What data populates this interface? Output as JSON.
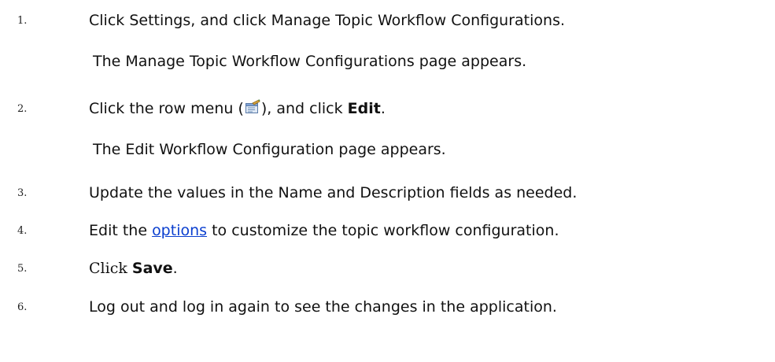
{
  "steps": [
    {
      "number": "1.",
      "text": "Click Settings, and click Manage Topic Workflow Configurations.",
      "result": "The Manage Topic Workflow Configurations page appears."
    },
    {
      "number": "2.",
      "text_before": "Click the row menu (",
      "icon": "row-menu-icon",
      "text_middle": "), and click ",
      "bold": "Edit",
      "text_after": ".",
      "result": "The Edit Workflow Configuration page appears."
    },
    {
      "number": "3.",
      "text": "Update the values in the Name and Description fields as needed."
    },
    {
      "number": "4.",
      "text_before": "Edit the ",
      "link": "options",
      "text_after": " to customize the topic workflow configuration."
    },
    {
      "number": "5.",
      "text_before": "Click ",
      "bold": "Save",
      "text_after": "."
    },
    {
      "number": "6.",
      "text": "Log out and log in again to see the changes in the application."
    }
  ],
  "colors": {
    "link": "#0b3fcf",
    "text": "#111111"
  }
}
